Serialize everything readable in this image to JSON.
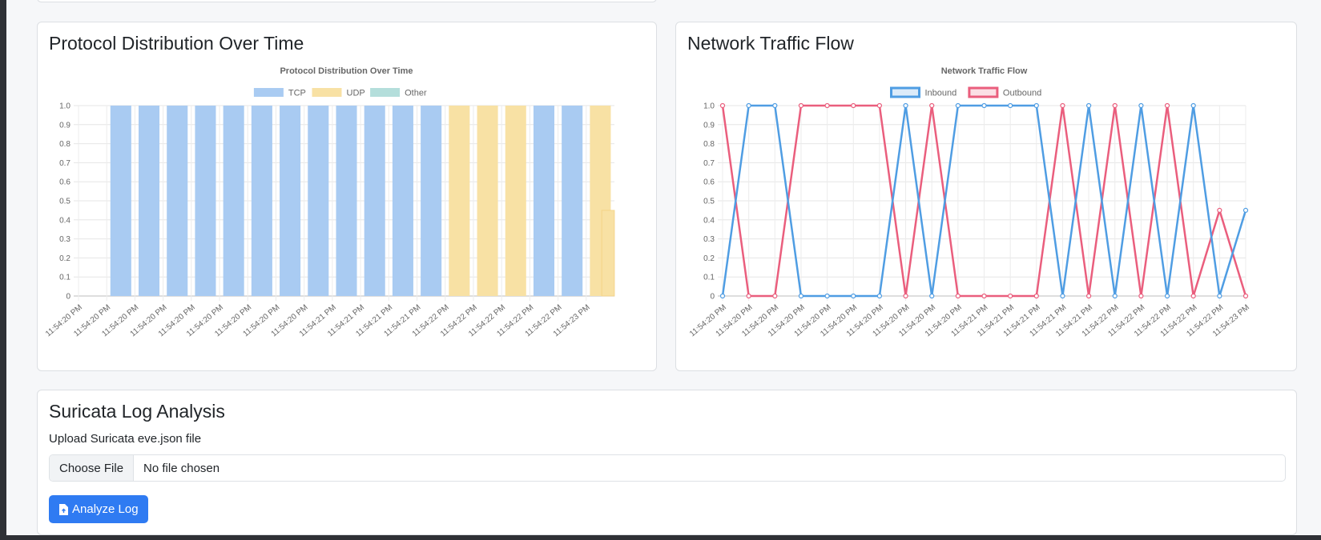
{
  "protocol_card": {
    "title": "Protocol Distribution Over Time"
  },
  "traffic_card": {
    "title": "Network Traffic Flow"
  },
  "suricata": {
    "title": "Suricata Log Analysis",
    "upload_label": "Upload Suricata eve.json file",
    "choose_file_label": "Choose File",
    "no_file_text": "No file chosen",
    "analyze_label": "Analyze Log",
    "analyze_icon": "file-upload-icon"
  },
  "colors": {
    "tcp": "#a9cbf2",
    "udp": "#f8e1a4",
    "other": "#b4dedb",
    "inbound": "#4f9de3",
    "outbound": "#ea5e7d",
    "accent": "#2f7bf2"
  },
  "chart_data": [
    {
      "type": "bar",
      "title": "Protocol Distribution Over Time",
      "legend_position": "top",
      "grid": true,
      "ylim": [
        0,
        1
      ],
      "yticks": [
        "0",
        "0.1",
        "0.2",
        "0.3",
        "0.4",
        "0.5",
        "0.6",
        "0.7",
        "0.8",
        "0.9",
        "1.0"
      ],
      "categories": [
        "11:54:20 PM",
        "11:54:20 PM",
        "11:54:20 PM",
        "11:54:20 PM",
        "11:54:20 PM",
        "11:54:20 PM",
        "11:54:20 PM",
        "11:54:20 PM",
        "11:54:20 PM",
        "11:54:21 PM",
        "11:54:21 PM",
        "11:54:21 PM",
        "11:54:21 PM",
        "11:54:22 PM",
        "11:54:22 PM",
        "11:54:22 PM",
        "11:54:22 PM",
        "11:54:22 PM",
        "11:54:23 PM"
      ],
      "series": [
        {
          "name": "TCP",
          "values": [
            0,
            1,
            1,
            1,
            1,
            1,
            1,
            1,
            1,
            1,
            1,
            1,
            1,
            0,
            0,
            0,
            1,
            1,
            0
          ]
        },
        {
          "name": "UDP",
          "values": [
            0,
            0,
            0,
            0,
            0,
            0,
            0,
            0,
            0,
            0,
            0,
            0,
            0,
            1,
            1,
            1,
            0,
            0,
            1
          ]
        },
        {
          "name": "Other",
          "values": [
            0,
            0,
            0,
            0,
            0,
            0,
            0,
            0,
            0,
            0,
            0,
            0,
            0,
            0,
            0,
            0,
            0,
            0,
            0
          ]
        }
      ],
      "trailing_partial_udp": 0.45
    },
    {
      "type": "line",
      "title": "Network Traffic Flow",
      "legend_position": "top",
      "grid": true,
      "ylim": [
        0,
        1
      ],
      "yticks": [
        "0",
        "0.1",
        "0.2",
        "0.3",
        "0.4",
        "0.5",
        "0.6",
        "0.7",
        "0.8",
        "0.9",
        "1.0"
      ],
      "categories": [
        "11:54:20 PM",
        "11:54:20 PM",
        "11:54:20 PM",
        "11:54:20 PM",
        "11:54:20 PM",
        "11:54:20 PM",
        "11:54:20 PM",
        "11:54:20 PM",
        "11:54:20 PM",
        "11:54:20 PM",
        "11:54:21 PM",
        "11:54:21 PM",
        "11:54:21 PM",
        "11:54:21 PM",
        "11:54:21 PM",
        "11:54:22 PM",
        "11:54:22 PM",
        "11:54:22 PM",
        "11:54:22 PM",
        "11:54:22 PM",
        "11:54:23 PM"
      ],
      "series": [
        {
          "name": "Inbound",
          "values": [
            0,
            1,
            1,
            0,
            0,
            0,
            0,
            1,
            0,
            1,
            1,
            1,
            1,
            0,
            1,
            0,
            1,
            0,
            1,
            0,
            0.45
          ]
        },
        {
          "name": "Outbound",
          "values": [
            1,
            0,
            0,
            1,
            1,
            1,
            1,
            0,
            1,
            0,
            0,
            0,
            0,
            1,
            0,
            1,
            0,
            1,
            0,
            0.45,
            0
          ]
        }
      ]
    }
  ]
}
